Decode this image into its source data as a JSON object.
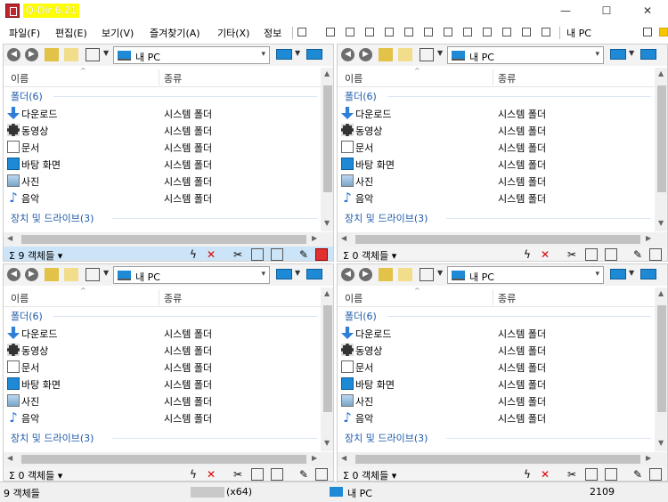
{
  "app": {
    "title": "Q-Dir 6.21"
  },
  "window_controls": {
    "minimize": "—",
    "maximize": "☐",
    "close": "✕"
  },
  "menu": {
    "items": [
      "파일(F)",
      "편집(E)",
      "보기(V)",
      "즐겨찾기(A)",
      "기타(X)",
      "정보"
    ],
    "toolbar_location": "내 PC"
  },
  "columns": {
    "name": "이름",
    "type": "종류"
  },
  "groups": {
    "folders": "폴더(6)",
    "drives": "장치 및 드라이브(3)"
  },
  "items": [
    {
      "name": "다운로드",
      "type": "시스템 폴더",
      "icon": "download-icon"
    },
    {
      "name": "동영상",
      "type": "시스템 폴더",
      "icon": "video-icon"
    },
    {
      "name": "문서",
      "type": "시스템 폴더",
      "icon": "document-icon"
    },
    {
      "name": "바탕 화면",
      "type": "시스템 폴더",
      "icon": "desktop-icon"
    },
    {
      "name": "사진",
      "type": "시스템 폴더",
      "icon": "pictures-icon"
    },
    {
      "name": "음악",
      "type": "시스템 폴더",
      "icon": "music-icon"
    }
  ],
  "panes": [
    {
      "address": "내 PC",
      "status": "Σ 9 객체들 ▾",
      "active": true
    },
    {
      "address": "내 PC",
      "status": "Σ 0 객체들 ▾",
      "active": false
    },
    {
      "address": "내 PC",
      "status": "Σ 0 객체들 ▾",
      "active": false
    },
    {
      "address": "내 PC",
      "status": "Σ 0 객체들 ▾",
      "active": false
    }
  ],
  "statusbar": {
    "objects": "9 객체들",
    "arch": "(x64)",
    "location": "내 PC",
    "number": "2109"
  },
  "colors": {
    "accent": "#1e8ad6",
    "group_text": "#1e5aa8",
    "active_status": "#cce4f7"
  }
}
